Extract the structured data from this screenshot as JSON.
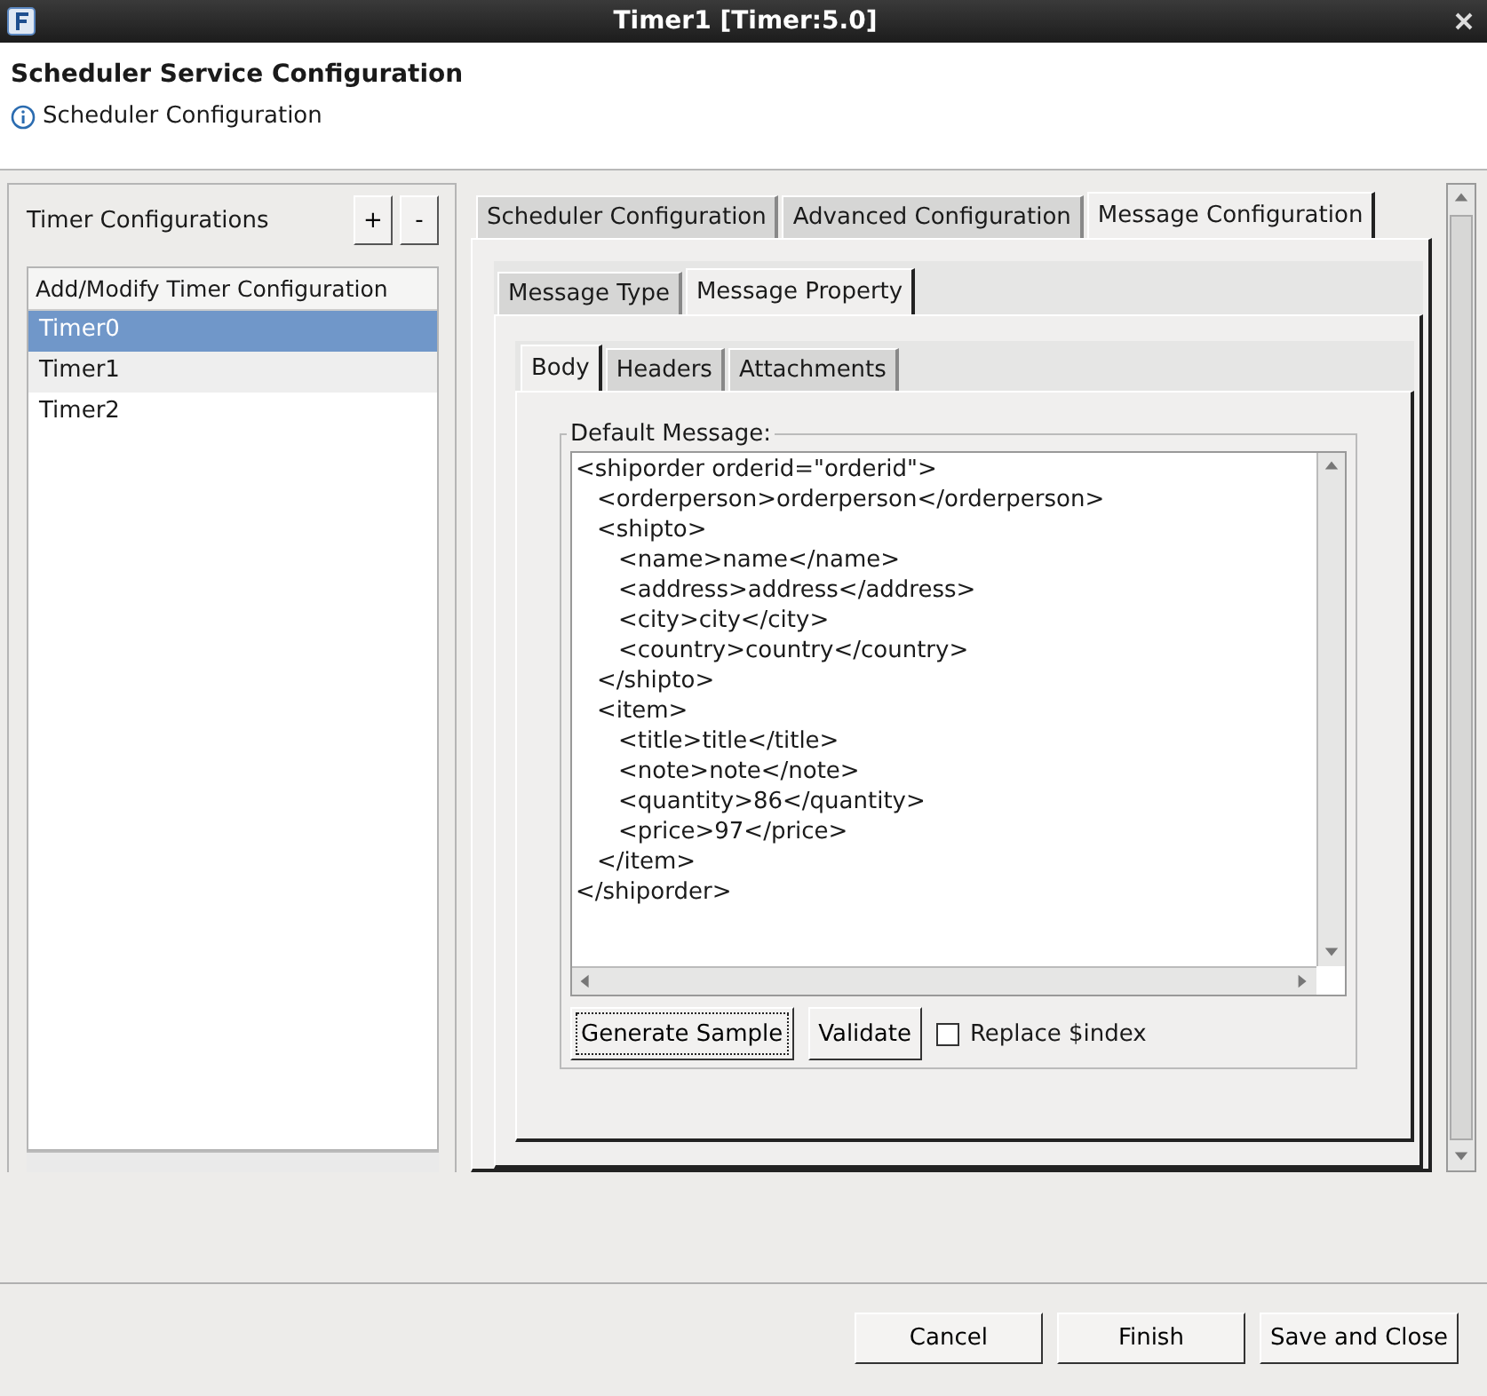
{
  "window": {
    "title": "Timer1 [Timer:5.0]"
  },
  "header": {
    "title": "Scheduler Service Configuration",
    "info": "Scheduler Configuration"
  },
  "timer_panel": {
    "title": "Timer Configurations",
    "add": "+",
    "remove": "-",
    "column": "Add/Modify Timer Configuration",
    "items": [
      {
        "label": "Timer0",
        "selected": true
      },
      {
        "label": "Timer1",
        "selected": false
      },
      {
        "label": "Timer2",
        "selected": false
      }
    ]
  },
  "tabs": [
    {
      "label": "Scheduler Configuration",
      "selected": false
    },
    {
      "label": "Advanced Configuration",
      "selected": false
    },
    {
      "label": "Message Configuration",
      "selected": true
    }
  ],
  "sub_tabs": [
    {
      "label": "Message Type",
      "selected": false
    },
    {
      "label": "Message Property",
      "selected": true
    }
  ],
  "property_tabs": [
    {
      "label": "Body",
      "selected": true
    },
    {
      "label": "Headers",
      "selected": false
    },
    {
      "label": "Attachments",
      "selected": false
    }
  ],
  "default_message": {
    "legend": "Default Message:",
    "lines": [
      {
        "text": "<shiporder orderid=\"orderid\">",
        "children": [
          {
            "text": "<orderperson>orderperson</orderperson>"
          },
          {
            "text": "<shipto>",
            "children": [
              {
                "text": "<name>name</name>"
              },
              {
                "text": "<address>address</address>"
              },
              {
                "text": "<city>city</city>"
              },
              {
                "text": "<country>country</country>"
              }
            ]
          },
          {
            "text": "</shipto>"
          },
          {
            "text": "<item>",
            "children": [
              {
                "text": "<title>title</title>"
              },
              {
                "text": "<note>note</note>"
              },
              {
                "text": "<quantity>86</quantity>"
              },
              {
                "text": "<price>97</price>"
              }
            ]
          },
          {
            "text": "</item>"
          }
        ]
      },
      {
        "text": "</shiporder>"
      }
    ]
  },
  "actions": {
    "generate": "Generate Sample",
    "validate": "Validate",
    "replace": {
      "label": "Replace $index",
      "checked": false
    }
  },
  "buttons": [
    "Cancel",
    "Finish",
    "Save and Close"
  ]
}
